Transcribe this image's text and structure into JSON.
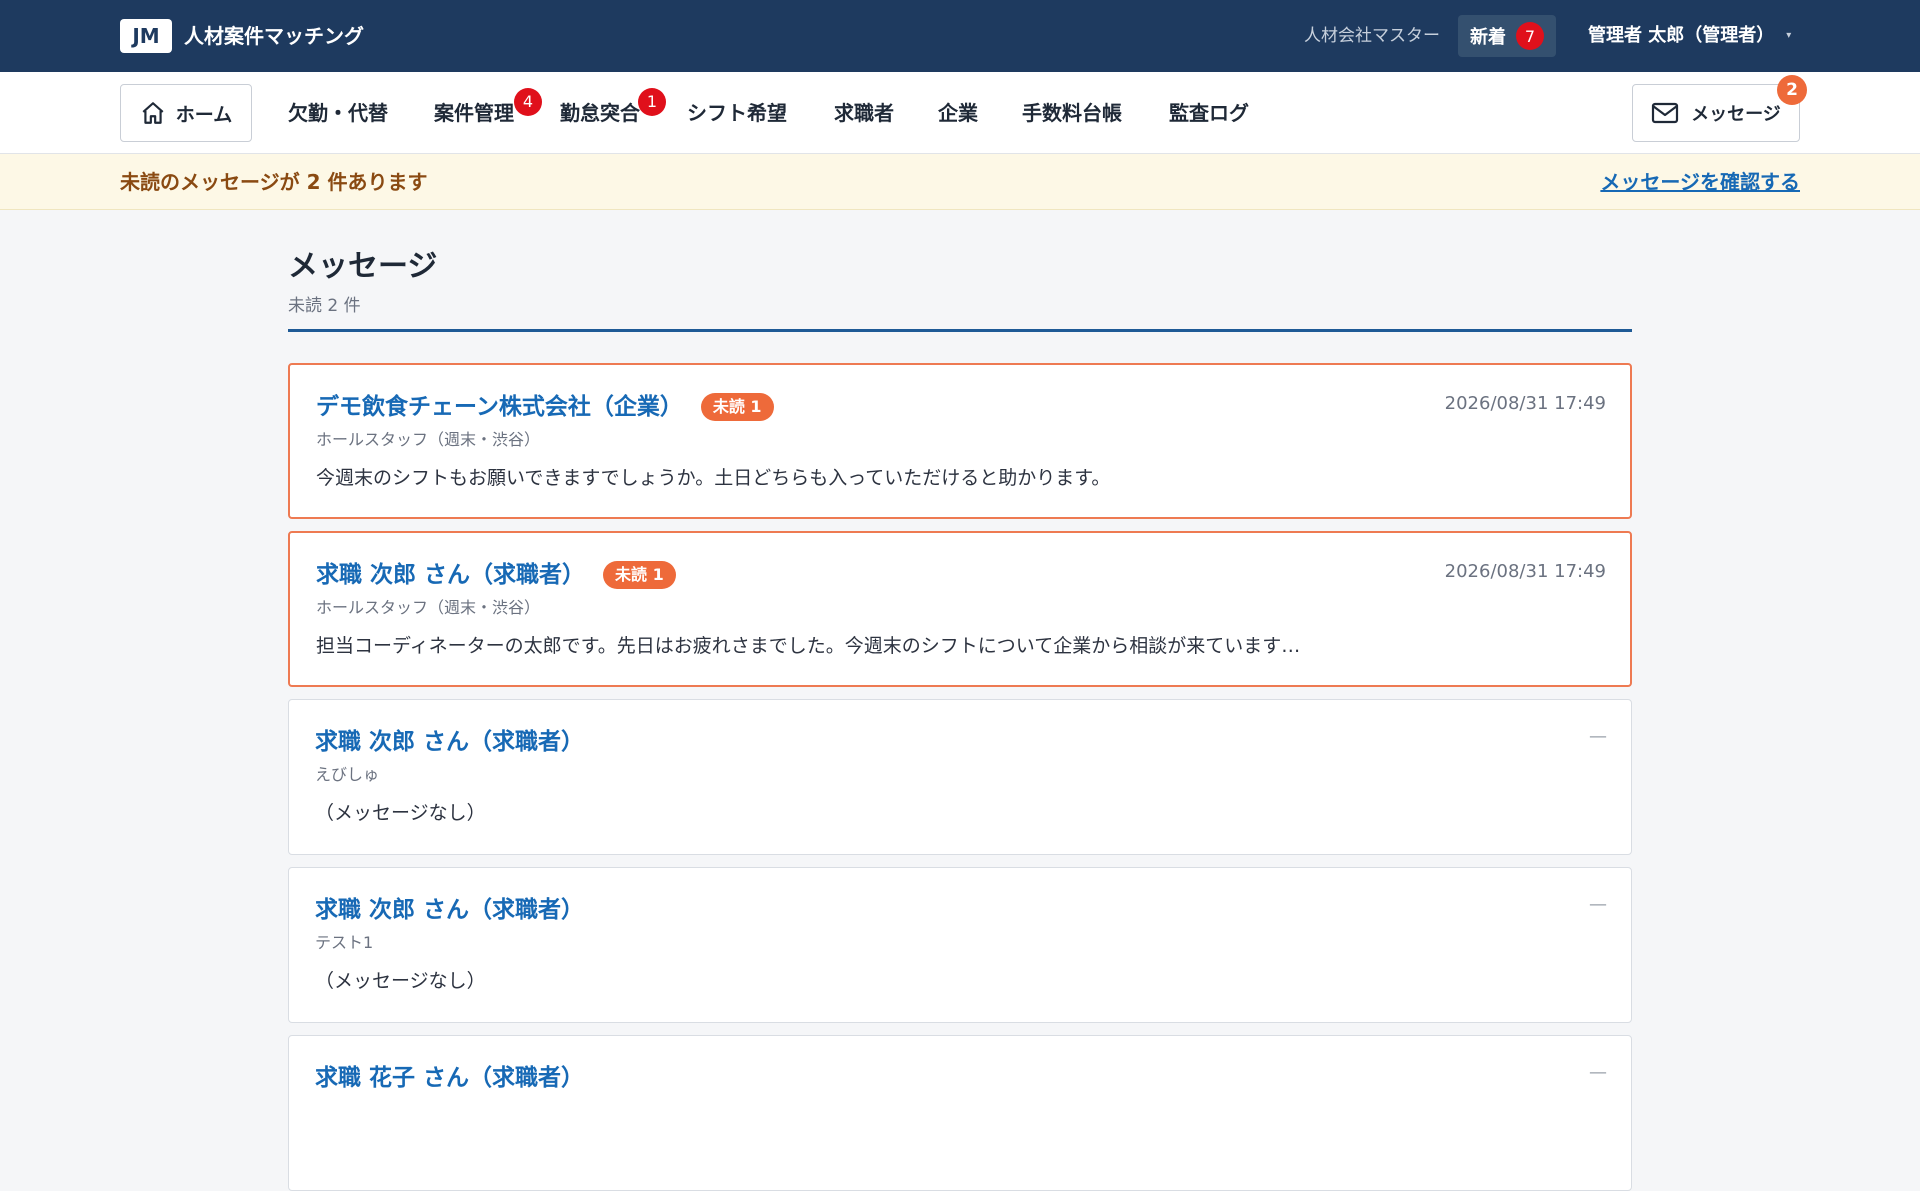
{
  "header": {
    "logo_text": "JM",
    "app_name": "人材案件マッチング",
    "company_name": "人材会社マスター",
    "new_label": "新着",
    "new_count": "7",
    "user_label": "管理者 太郎（管理者）",
    "caret": "▾"
  },
  "nav": {
    "home_label": "ホーム",
    "items": [
      {
        "label": "欠勤・代替",
        "badge": ""
      },
      {
        "label": "案件管理",
        "badge": "4"
      },
      {
        "label": "勤怠突合",
        "badge": "1"
      },
      {
        "label": "シフト希望",
        "badge": ""
      },
      {
        "label": "求職者",
        "badge": ""
      },
      {
        "label": "企業",
        "badge": ""
      },
      {
        "label": "手数料台帳",
        "badge": ""
      },
      {
        "label": "監査ログ",
        "badge": ""
      }
    ],
    "message_label": "メッセージ",
    "message_count": "2"
  },
  "notice": {
    "text": "未読のメッセージが 2 件あります",
    "link": "メッセージを確認する"
  },
  "main": {
    "title": "メッセージ",
    "subtitle": "未読 2 件",
    "threads": [
      {
        "title": "デモ飲食チェーン株式会社（企業）",
        "unread_badge": "未読 1",
        "subtitle": "ホールスタッフ（週末・渋谷）",
        "body": "今週末のシフトもお願いできますでしょうか。土日どちらも入っていただけると助かります。",
        "time": "2026/08/31 17:49",
        "unread": true
      },
      {
        "title": "求職 次郎 さん（求職者）",
        "unread_badge": "未読 1",
        "subtitle": "ホールスタッフ（週末・渋谷）",
        "body": "担当コーディネーターの太郎です。先日はお疲れさまでした。今週末のシフトについて企業から相談が来ています…",
        "time": "2026/08/31 17:49",
        "unread": true
      },
      {
        "title": "求職 次郎 さん（求職者）",
        "unread_badge": "",
        "subtitle": "えびしゅ",
        "body": "（メッセージなし）",
        "time": "—",
        "unread": false
      },
      {
        "title": "求職 次郎 さん（求職者）",
        "unread_badge": "",
        "subtitle": "テスト1",
        "body": "（メッセージなし）",
        "time": "—",
        "unread": false
      },
      {
        "title": "求職 花子 さん（求職者）",
        "unread_badge": "",
        "subtitle": "",
        "body": "",
        "time": "—",
        "unread": false
      }
    ]
  },
  "colors": {
    "header_bg": "#1e3a5f",
    "accent_link": "#1769b5",
    "unread_orange": "#ee6a3a",
    "badge_red": "#e0101b",
    "notice_bg": "#fdf8e6"
  },
  "icons": {
    "home": "home-icon",
    "message": "mail-icon"
  }
}
